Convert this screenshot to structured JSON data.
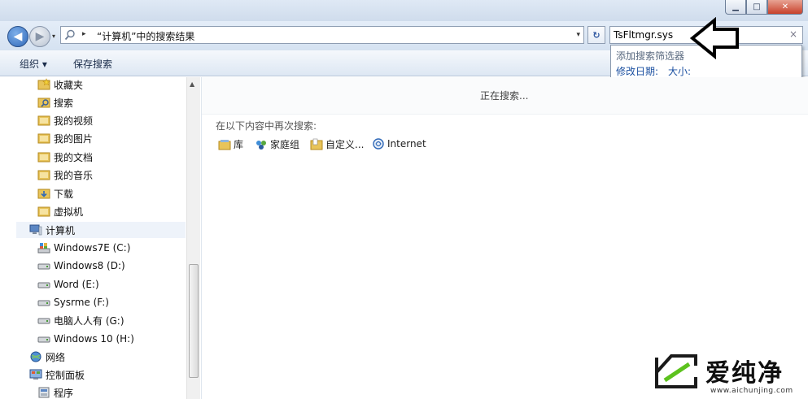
{
  "window": {
    "min_glyph": "▁",
    "max_glyph": "□",
    "close_glyph": "✕"
  },
  "nav": {
    "back_glyph": "◀",
    "forward_glyph": "▶",
    "drop_glyph": "▾"
  },
  "address": {
    "separator": "▸",
    "path": "“计算机”中的搜索结果",
    "drop_glyph": "▾"
  },
  "refresh_glyph": "↻",
  "search": {
    "value": "TsFltmgr.sys",
    "clear_glyph": "×"
  },
  "toolbar": {
    "organize": "组织 ▾",
    "save_search": "保存搜索"
  },
  "suggest": {
    "title": "添加搜索筛选器",
    "filter_date": "修改日期:",
    "filter_size": "大小:"
  },
  "sidebar": {
    "scroll_up_glyph": "▲",
    "items": [
      {
        "label": "收藏夹",
        "icon": "favorites-icon"
      },
      {
        "label": "搜索",
        "icon": "search-folder-icon"
      },
      {
        "label": "我的视频",
        "icon": "folder-icon"
      },
      {
        "label": "我的图片",
        "icon": "folder-icon"
      },
      {
        "label": "我的文档",
        "icon": "folder-icon"
      },
      {
        "label": "我的音乐",
        "icon": "folder-icon"
      },
      {
        "label": "下载",
        "icon": "download-folder-icon"
      },
      {
        "label": "虚拟机",
        "icon": "folder-icon"
      },
      {
        "label": "计算机",
        "icon": "computer-icon"
      },
      {
        "label": "Windows7E (C:)",
        "icon": "system-drive-icon"
      },
      {
        "label": "Windows8 (D:)",
        "icon": "drive-icon"
      },
      {
        "label": "Word (E:)",
        "icon": "drive-icon"
      },
      {
        "label": "Sysrme (F:)",
        "icon": "drive-icon"
      },
      {
        "label": "电脑人人有 (G:)",
        "icon": "drive-icon"
      },
      {
        "label": "Windows 10 (H:)",
        "icon": "drive-icon"
      },
      {
        "label": "网络",
        "icon": "network-icon"
      },
      {
        "label": "控制面板",
        "icon": "control-panel-icon"
      },
      {
        "label": "程序",
        "icon": "program-icon"
      }
    ]
  },
  "content": {
    "status": "正在搜索...",
    "search_again": "在以下内容中再次搜索:",
    "locations": [
      {
        "label": "库",
        "icon": "library-icon"
      },
      {
        "label": "家庭组",
        "icon": "homegroup-icon"
      },
      {
        "label": "自定义...",
        "icon": "custom-folder-icon"
      },
      {
        "label": "Internet",
        "icon": "internet-icon"
      }
    ]
  },
  "watermark": {
    "text": "爱纯净",
    "url": "www.aichunjing.com"
  },
  "colors": {
    "accent": "#1a4fa0",
    "toolbar": "#dde7f3",
    "folder": "#e8c45a"
  }
}
